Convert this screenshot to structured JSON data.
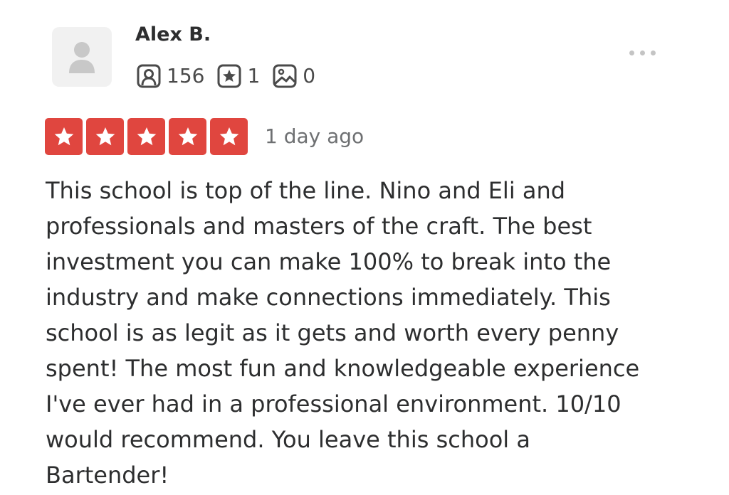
{
  "user": {
    "name": "Alex B.",
    "avatar_icon": "user-silhouette-icon",
    "stats": {
      "friends": "156",
      "reviews": "1",
      "photos": "0"
    },
    "icons": {
      "friends": "friends-icon",
      "reviews": "review-star-icon",
      "photos": "photo-icon"
    }
  },
  "menu": {
    "icon": "more-options-icon"
  },
  "review": {
    "rating": 5,
    "max_rating": 5,
    "date": "1 day ago",
    "text": "This school is top of the line. Nino and Eli and\nprofessionals and masters of the craft. The best\ninvestment you can make 100% to break into the\nindustry and make connections immediately. This\nschool is as legit as it gets and worth every penny\nspent! The most fun and knowledgeable experience\nI've ever had in a professional environment. 10/10\nwould recommend. You leave this school a\nBartender!"
  },
  "colors": {
    "star_background": "#e0463f",
    "avatar_background": "#f1f1f1",
    "text": "#2d2e2f",
    "muted": "#6e7072"
  }
}
